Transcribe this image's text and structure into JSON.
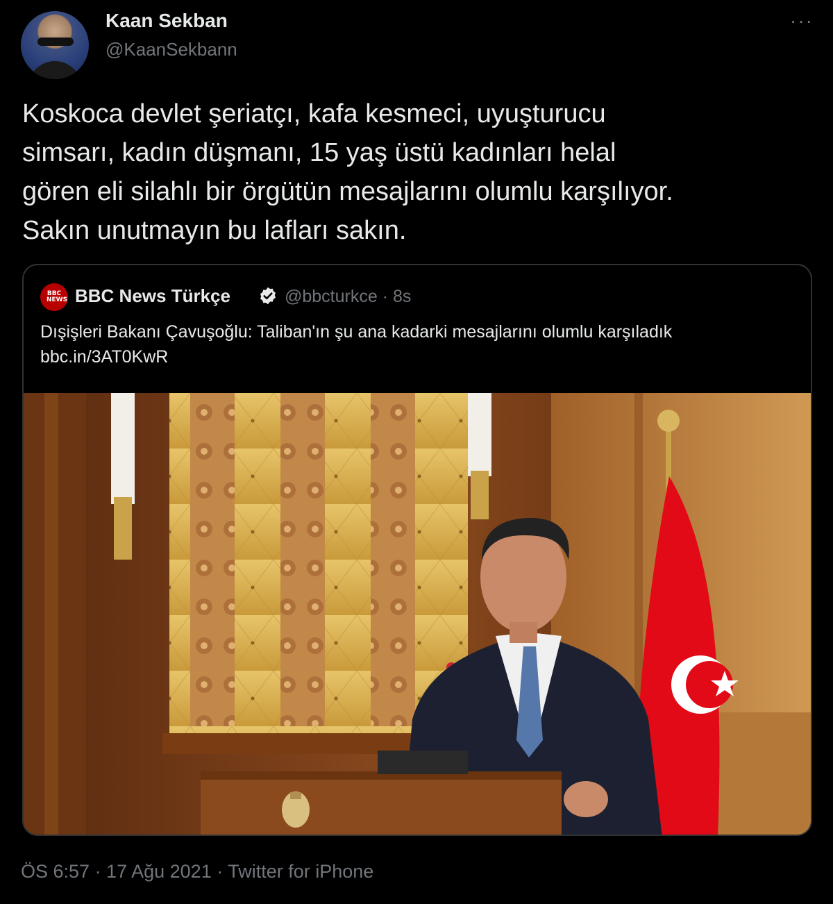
{
  "tweet": {
    "author_name": "Kaan Sekban",
    "author_handle": "@KaanSekbann",
    "more_label": "···",
    "text": "Koskoca devlet şeriatçı, kafa kesmeci, uyuşturucu\nsimsarı, kadın düşmanı, 15 yaş üstü kadınları helal\ngören eli silahlı bir örgütün mesajlarını olumlu karşılıyor.\nSakın unutmayın bu lafları sakın.",
    "time": "ÖS 6:57 · 17 Ağu 2021 · Twitter for iPhone"
  },
  "quoted_tweet": {
    "author_name": "BBC News Türkçe",
    "avatar_text": "BBC NEWS",
    "verified": true,
    "meta": "@bbcturkce · 8s",
    "text_line1": "Dışişleri Bakanı Çavuşoğlu: Taliban'ın şu ana kadarki mesajlarını olumlu karşıladık",
    "text_line2": "bbc.in/3AT0KwR",
    "image_alt": "Man in dark suit speaking at a wooden podium in front of a Turkish flag"
  },
  "colors": {
    "background": "#000000",
    "text": "#e7e9ea",
    "secondary": "#71767b",
    "border": "#2f3336",
    "bbc_red": "#b80000",
    "flag_red": "#e30a17"
  }
}
